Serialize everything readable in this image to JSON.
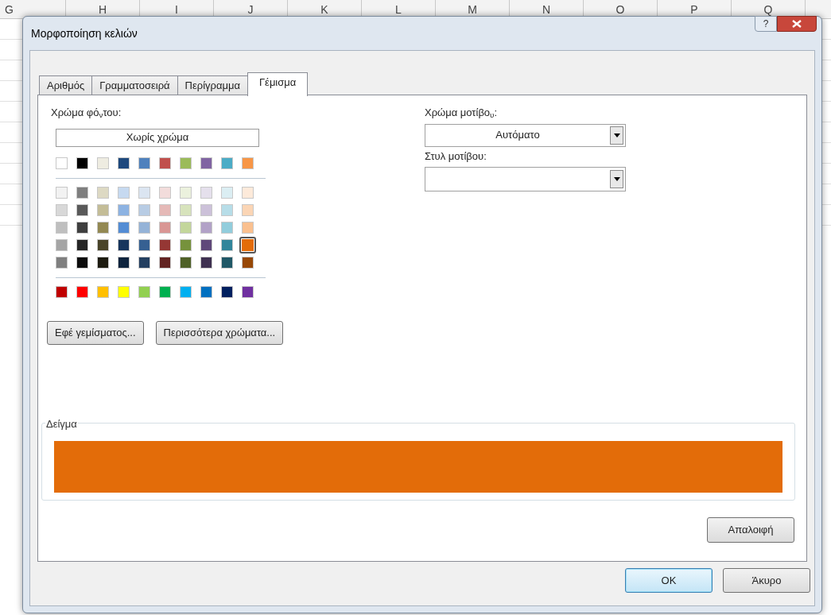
{
  "sheet": {
    "columns": [
      "G",
      "H",
      "I",
      "J",
      "K",
      "L",
      "M",
      "N",
      "O",
      "P",
      "Q"
    ]
  },
  "window": {
    "title": "Μορφοποίηση κελιών",
    "help": "?"
  },
  "tabs": [
    {
      "label": "Αριθμός",
      "selected": false
    },
    {
      "label": "Γραμματοσειρά",
      "selected": false
    },
    {
      "label": "Περίγραμμα",
      "selected": false
    },
    {
      "label": "Γέμισμα",
      "selected": true
    }
  ],
  "background_color": {
    "label": "Χρώμα φό$_{ν}$του:",
    "no_color_button": "Χωρίς χρώμα",
    "palette_groups": [
      [
        [
          {
            "color": "#ffffff",
            "selected": false
          },
          {
            "color": "#000000",
            "selected": false
          },
          {
            "color": "#eeece1",
            "selected": false
          },
          {
            "color": "#1f497d",
            "selected": false
          },
          {
            "color": "#4f81bd",
            "selected": false
          },
          {
            "color": "#c0504d",
            "selected": false
          },
          {
            "color": "#9bbb59",
            "selected": false
          },
          {
            "color": "#8064a2",
            "selected": false
          },
          {
            "color": "#4bacc6",
            "selected": false
          },
          {
            "color": "#f79646",
            "selected": false
          }
        ]
      ],
      [
        [
          {
            "color": "#f2f2f2",
            "selected": false
          },
          {
            "color": "#7f7f7f",
            "selected": false
          },
          {
            "color": "#ddd9c3",
            "selected": false
          },
          {
            "color": "#c6d9f0",
            "selected": false
          },
          {
            "color": "#dbe5f1",
            "selected": false
          },
          {
            "color": "#f2dcdb",
            "selected": false
          },
          {
            "color": "#ebf1dd",
            "selected": false
          },
          {
            "color": "#e5e0ec",
            "selected": false
          },
          {
            "color": "#dbeef3",
            "selected": false
          },
          {
            "color": "#fdeada",
            "selected": false
          }
        ],
        [
          {
            "color": "#d8d8d8",
            "selected": false
          },
          {
            "color": "#595959",
            "selected": false
          },
          {
            "color": "#c4bd97",
            "selected": false
          },
          {
            "color": "#8db3e2",
            "selected": false
          },
          {
            "color": "#b8cce4",
            "selected": false
          },
          {
            "color": "#e5b9b7",
            "selected": false
          },
          {
            "color": "#d7e3bc",
            "selected": false
          },
          {
            "color": "#ccc1d9",
            "selected": false
          },
          {
            "color": "#b7dde8",
            "selected": false
          },
          {
            "color": "#fbd5b5",
            "selected": false
          }
        ],
        [
          {
            "color": "#bfbfbf",
            "selected": false
          },
          {
            "color": "#3f3f3f",
            "selected": false
          },
          {
            "color": "#938953",
            "selected": false
          },
          {
            "color": "#548dd4",
            "selected": false
          },
          {
            "color": "#95b3d7",
            "selected": false
          },
          {
            "color": "#d99694",
            "selected": false
          },
          {
            "color": "#c3d69b",
            "selected": false
          },
          {
            "color": "#b2a2c7",
            "selected": false
          },
          {
            "color": "#92cddc",
            "selected": false
          },
          {
            "color": "#fac08f",
            "selected": false
          }
        ],
        [
          {
            "color": "#a5a5a5",
            "selected": false
          },
          {
            "color": "#262626",
            "selected": false
          },
          {
            "color": "#494429",
            "selected": false
          },
          {
            "color": "#17365d",
            "selected": false
          },
          {
            "color": "#366092",
            "selected": false
          },
          {
            "color": "#953734",
            "selected": false
          },
          {
            "color": "#76923c",
            "selected": false
          },
          {
            "color": "#5f497a",
            "selected": false
          },
          {
            "color": "#31859b",
            "selected": false
          },
          {
            "color": "#e36c09",
            "selected": true
          }
        ],
        [
          {
            "color": "#7f7f7f",
            "selected": false
          },
          {
            "color": "#0c0c0c",
            "selected": false
          },
          {
            "color": "#1d1b10",
            "selected": false
          },
          {
            "color": "#0f243e",
            "selected": false
          },
          {
            "color": "#244061",
            "selected": false
          },
          {
            "color": "#632423",
            "selected": false
          },
          {
            "color": "#4f6128",
            "selected": false
          },
          {
            "color": "#3f3151",
            "selected": false
          },
          {
            "color": "#205867",
            "selected": false
          },
          {
            "color": "#974806",
            "selected": false
          }
        ]
      ],
      [
        [
          {
            "color": "#c00000",
            "selected": false
          },
          {
            "color": "#ff0000",
            "selected": false
          },
          {
            "color": "#ffc000",
            "selected": false
          },
          {
            "color": "#ffff00",
            "selected": false
          },
          {
            "color": "#92d050",
            "selected": false
          },
          {
            "color": "#00b050",
            "selected": false
          },
          {
            "color": "#00b0f0",
            "selected": false
          },
          {
            "color": "#0070c0",
            "selected": false
          },
          {
            "color": "#002060",
            "selected": false
          },
          {
            "color": "#7030a0",
            "selected": false
          }
        ]
      ]
    ],
    "buttons": [
      "Εφέ γεμίσματος...",
      "Περισσότερα χρώματα..."
    ]
  },
  "pattern_color": {
    "label": "Χρώμα μοτίβο$_{υ}$:",
    "value": "Αυτόματο"
  },
  "pattern_style": {
    "label": "Στυλ μοτίβου:"
  },
  "sample": {
    "label": "Δείγμα",
    "color": "#e36c09"
  },
  "clear_button": "Απαλοιφή",
  "footer_buttons": [
    {
      "label": "OK",
      "default": true
    },
    {
      "label": "Άκυρο",
      "default": false
    }
  ]
}
